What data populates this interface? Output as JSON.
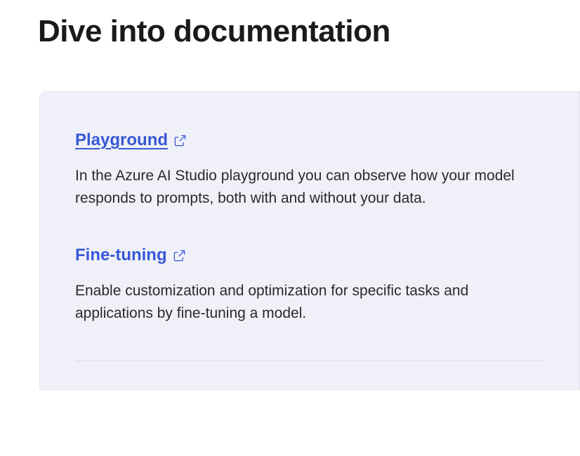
{
  "heading": "Dive into documentation",
  "items": [
    {
      "title": "Playground",
      "description": "In the Azure AI Studio playground you can observe how your model responds to prompts, both with and without your data.",
      "underlined": true
    },
    {
      "title": "Fine-tuning",
      "description": "Enable customization and optimization for specific tasks and applications by fine-tuning a model.",
      "underlined": false
    }
  ]
}
